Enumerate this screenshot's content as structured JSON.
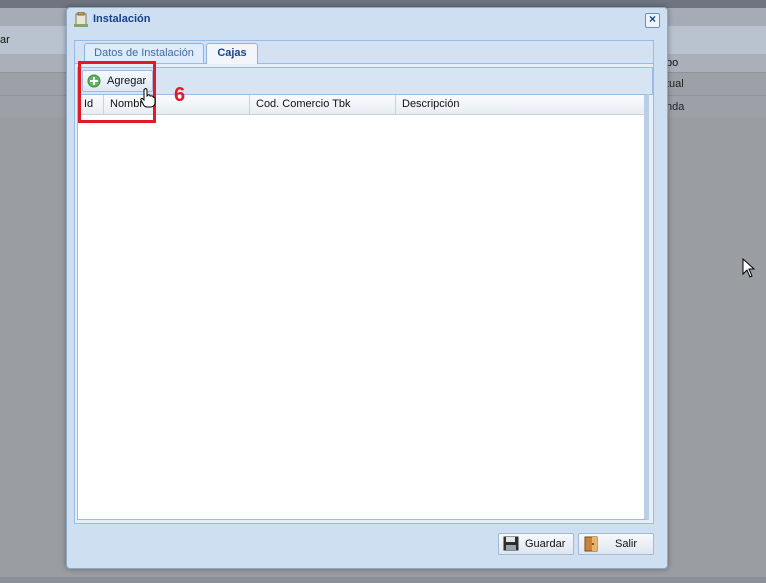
{
  "background": {
    "toolbar_fragment": "ar",
    "column_fragment": "po",
    "rows": [
      "tual",
      "nda"
    ]
  },
  "window": {
    "title": "Instalación",
    "close_symbol": "×",
    "tabs": [
      {
        "label": "Datos de Instalación",
        "active": false
      },
      {
        "label": "Cajas",
        "active": true
      }
    ],
    "toolbar": {
      "add_label": "Agregar"
    },
    "grid": {
      "columns": [
        "Id",
        "Nombre",
        "Cod. Comercio Tbk",
        "Descripción"
      ],
      "rows": []
    },
    "footer": {
      "save_label": "Guardar",
      "exit_label": "Salir"
    }
  },
  "annotation": {
    "step_number": "6",
    "color": "#e01b24"
  },
  "icons": {
    "title": "app-icon",
    "add": "plus-circle-icon",
    "save": "floppy-disk-icon",
    "exit": "door-icon",
    "pointer": "hand-pointer-icon"
  }
}
